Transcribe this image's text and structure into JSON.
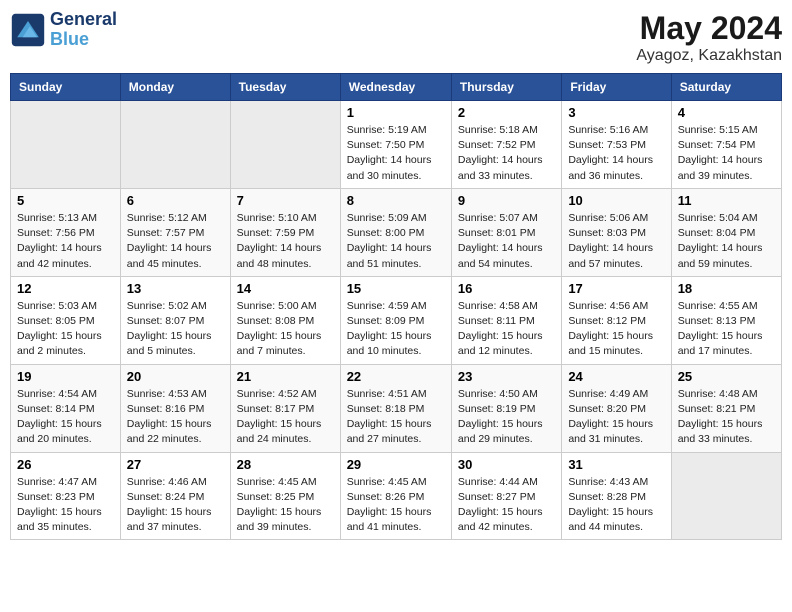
{
  "header": {
    "logo_line1": "General",
    "logo_line2": "Blue",
    "month": "May 2024",
    "location": "Ayagoz, Kazakhstan"
  },
  "weekdays": [
    "Sunday",
    "Monday",
    "Tuesday",
    "Wednesday",
    "Thursday",
    "Friday",
    "Saturday"
  ],
  "weeks": [
    [
      {
        "day": "",
        "info": ""
      },
      {
        "day": "",
        "info": ""
      },
      {
        "day": "",
        "info": ""
      },
      {
        "day": "1",
        "info": "Sunrise: 5:19 AM\nSunset: 7:50 PM\nDaylight: 14 hours\nand 30 minutes."
      },
      {
        "day": "2",
        "info": "Sunrise: 5:18 AM\nSunset: 7:52 PM\nDaylight: 14 hours\nand 33 minutes."
      },
      {
        "day": "3",
        "info": "Sunrise: 5:16 AM\nSunset: 7:53 PM\nDaylight: 14 hours\nand 36 minutes."
      },
      {
        "day": "4",
        "info": "Sunrise: 5:15 AM\nSunset: 7:54 PM\nDaylight: 14 hours\nand 39 minutes."
      }
    ],
    [
      {
        "day": "5",
        "info": "Sunrise: 5:13 AM\nSunset: 7:56 PM\nDaylight: 14 hours\nand 42 minutes."
      },
      {
        "day": "6",
        "info": "Sunrise: 5:12 AM\nSunset: 7:57 PM\nDaylight: 14 hours\nand 45 minutes."
      },
      {
        "day": "7",
        "info": "Sunrise: 5:10 AM\nSunset: 7:59 PM\nDaylight: 14 hours\nand 48 minutes."
      },
      {
        "day": "8",
        "info": "Sunrise: 5:09 AM\nSunset: 8:00 PM\nDaylight: 14 hours\nand 51 minutes."
      },
      {
        "day": "9",
        "info": "Sunrise: 5:07 AM\nSunset: 8:01 PM\nDaylight: 14 hours\nand 54 minutes."
      },
      {
        "day": "10",
        "info": "Sunrise: 5:06 AM\nSunset: 8:03 PM\nDaylight: 14 hours\nand 57 minutes."
      },
      {
        "day": "11",
        "info": "Sunrise: 5:04 AM\nSunset: 8:04 PM\nDaylight: 14 hours\nand 59 minutes."
      }
    ],
    [
      {
        "day": "12",
        "info": "Sunrise: 5:03 AM\nSunset: 8:05 PM\nDaylight: 15 hours\nand 2 minutes."
      },
      {
        "day": "13",
        "info": "Sunrise: 5:02 AM\nSunset: 8:07 PM\nDaylight: 15 hours\nand 5 minutes."
      },
      {
        "day": "14",
        "info": "Sunrise: 5:00 AM\nSunset: 8:08 PM\nDaylight: 15 hours\nand 7 minutes."
      },
      {
        "day": "15",
        "info": "Sunrise: 4:59 AM\nSunset: 8:09 PM\nDaylight: 15 hours\nand 10 minutes."
      },
      {
        "day": "16",
        "info": "Sunrise: 4:58 AM\nSunset: 8:11 PM\nDaylight: 15 hours\nand 12 minutes."
      },
      {
        "day": "17",
        "info": "Sunrise: 4:56 AM\nSunset: 8:12 PM\nDaylight: 15 hours\nand 15 minutes."
      },
      {
        "day": "18",
        "info": "Sunrise: 4:55 AM\nSunset: 8:13 PM\nDaylight: 15 hours\nand 17 minutes."
      }
    ],
    [
      {
        "day": "19",
        "info": "Sunrise: 4:54 AM\nSunset: 8:14 PM\nDaylight: 15 hours\nand 20 minutes."
      },
      {
        "day": "20",
        "info": "Sunrise: 4:53 AM\nSunset: 8:16 PM\nDaylight: 15 hours\nand 22 minutes."
      },
      {
        "day": "21",
        "info": "Sunrise: 4:52 AM\nSunset: 8:17 PM\nDaylight: 15 hours\nand 24 minutes."
      },
      {
        "day": "22",
        "info": "Sunrise: 4:51 AM\nSunset: 8:18 PM\nDaylight: 15 hours\nand 27 minutes."
      },
      {
        "day": "23",
        "info": "Sunrise: 4:50 AM\nSunset: 8:19 PM\nDaylight: 15 hours\nand 29 minutes."
      },
      {
        "day": "24",
        "info": "Sunrise: 4:49 AM\nSunset: 8:20 PM\nDaylight: 15 hours\nand 31 minutes."
      },
      {
        "day": "25",
        "info": "Sunrise: 4:48 AM\nSunset: 8:21 PM\nDaylight: 15 hours\nand 33 minutes."
      }
    ],
    [
      {
        "day": "26",
        "info": "Sunrise: 4:47 AM\nSunset: 8:23 PM\nDaylight: 15 hours\nand 35 minutes."
      },
      {
        "day": "27",
        "info": "Sunrise: 4:46 AM\nSunset: 8:24 PM\nDaylight: 15 hours\nand 37 minutes."
      },
      {
        "day": "28",
        "info": "Sunrise: 4:45 AM\nSunset: 8:25 PM\nDaylight: 15 hours\nand 39 minutes."
      },
      {
        "day": "29",
        "info": "Sunrise: 4:45 AM\nSunset: 8:26 PM\nDaylight: 15 hours\nand 41 minutes."
      },
      {
        "day": "30",
        "info": "Sunrise: 4:44 AM\nSunset: 8:27 PM\nDaylight: 15 hours\nand 42 minutes."
      },
      {
        "day": "31",
        "info": "Sunrise: 4:43 AM\nSunset: 8:28 PM\nDaylight: 15 hours\nand 44 minutes."
      },
      {
        "day": "",
        "info": ""
      }
    ]
  ],
  "colors": {
    "header_bg": "#2a5298",
    "header_text": "#ffffff",
    "even_row_bg": "#f0f4f8",
    "odd_row_bg": "#ffffff",
    "empty_bg": "#ebebeb"
  }
}
